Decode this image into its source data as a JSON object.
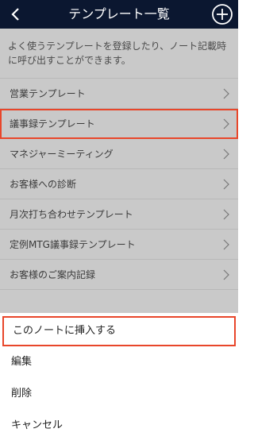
{
  "header": {
    "title": "テンプレート一覧"
  },
  "description": "よく使うテンプレートを登録したり、ノート記載時に呼び出すことができます。",
  "templates": [
    {
      "label": "営業テンプレート"
    },
    {
      "label": "議事録テンプレート"
    },
    {
      "label": "マネジャーミーティング"
    },
    {
      "label": "お客様への診断"
    },
    {
      "label": "月次打ち合わせテンプレート"
    },
    {
      "label": "定例MTG議事録テンプレート"
    },
    {
      "label": "お客様のご案内記録"
    }
  ],
  "actions": [
    {
      "label": "このノートに挿入する"
    },
    {
      "label": "編集"
    },
    {
      "label": "削除"
    },
    {
      "label": "キャンセル"
    }
  ],
  "colors": {
    "header_bg": "#0b1730",
    "highlight": "#e8462a",
    "overlay": "#c9c9c9"
  }
}
